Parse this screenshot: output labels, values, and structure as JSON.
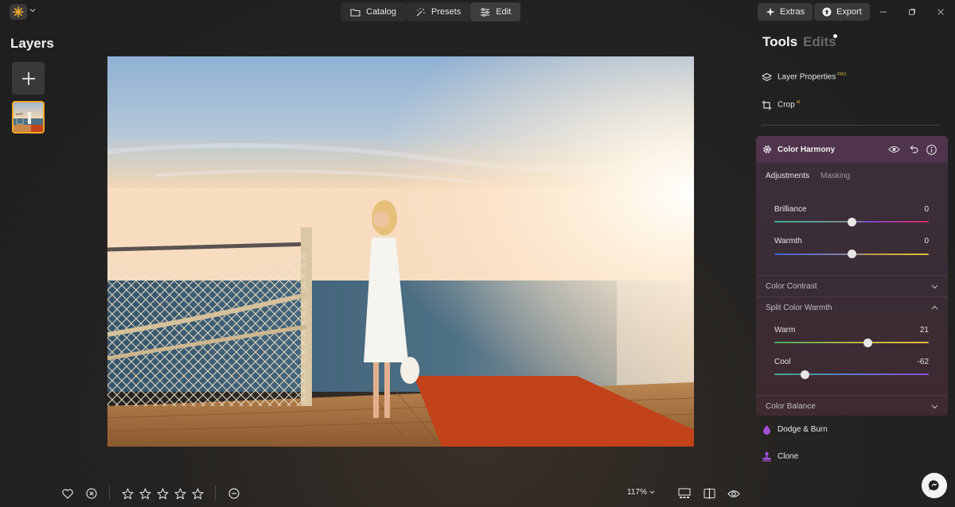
{
  "colors": {
    "accent": "#f1a82a",
    "panel_header": "#50344d",
    "pro_badge": "#e2b43b"
  },
  "topbar": {
    "app_icon": "sun-logo-icon",
    "tabs": [
      {
        "label": "Catalog",
        "icon": "folder-icon"
      },
      {
        "label": "Presets",
        "icon": "magic-wand-icon"
      },
      {
        "label": "Edit",
        "icon": "sliders-icon",
        "active": true
      }
    ],
    "extras_label": "Extras",
    "export_label": "Export"
  },
  "left_panel": {
    "title": "Layers"
  },
  "right_panel": {
    "tab_tools": "Tools",
    "tab_edits": "Edits",
    "layer_properties": {
      "label": "Layer Properties",
      "badge": "PRO"
    },
    "crop": {
      "label": "Crop",
      "badge": "AI"
    },
    "color_harmony": {
      "title": "Color Harmony",
      "sub_tabs": [
        "Adjustments",
        "Masking"
      ],
      "sliders_top": [
        {
          "label": "Brilliance",
          "value": "0",
          "fraction": 0.5
        },
        {
          "label": "Warmth",
          "value": "0",
          "fraction": 0.5
        }
      ],
      "color_contrast": "Color Contrast",
      "split_color_warmth": "Split Color Warmth",
      "sliders_split": [
        {
          "label": "Warm",
          "value": "21",
          "fraction": 0.605
        },
        {
          "label": "Cool",
          "value": "-62",
          "fraction": 0.2
        }
      ],
      "color_balance": "Color Balance"
    },
    "dodge_burn": "Dodge & Burn",
    "clone": "Clone"
  },
  "bottom_bar": {
    "zoom": "117%",
    "rating_stars": 5
  }
}
